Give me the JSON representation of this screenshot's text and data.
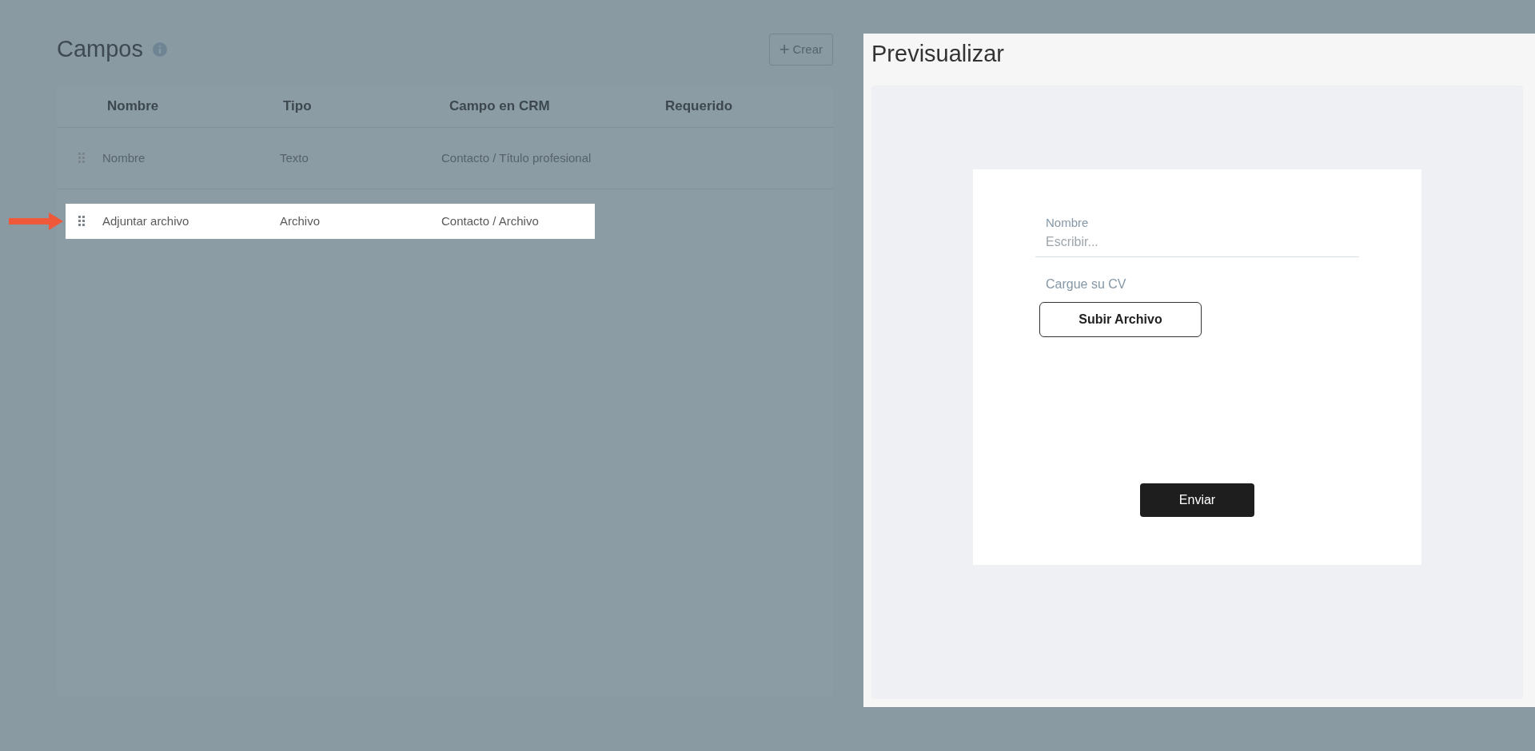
{
  "fields_panel": {
    "title": "Campos",
    "create_button": {
      "icon": "+",
      "label": "Crear"
    },
    "table": {
      "columns": [
        "Nombre",
        "Tipo",
        "Campo en CRM",
        "Requerido"
      ],
      "rows": [
        {
          "name": "Nombre",
          "type": "Texto",
          "crm_field": "Contacto / Título profesional",
          "dragging": false
        },
        {
          "name": "Adjuntar archivo",
          "type": "Archivo",
          "crm_field": "Contacto / Archivo",
          "dragging": true
        }
      ]
    }
  },
  "preview": {
    "title": "Previsualizar",
    "form": {
      "text_field": {
        "label": "Nombre",
        "placeholder": "Escribir..."
      },
      "upload": {
        "label": "Cargue su CV",
        "button": "Subir Archivo"
      },
      "submit": "Enviar"
    }
  }
}
